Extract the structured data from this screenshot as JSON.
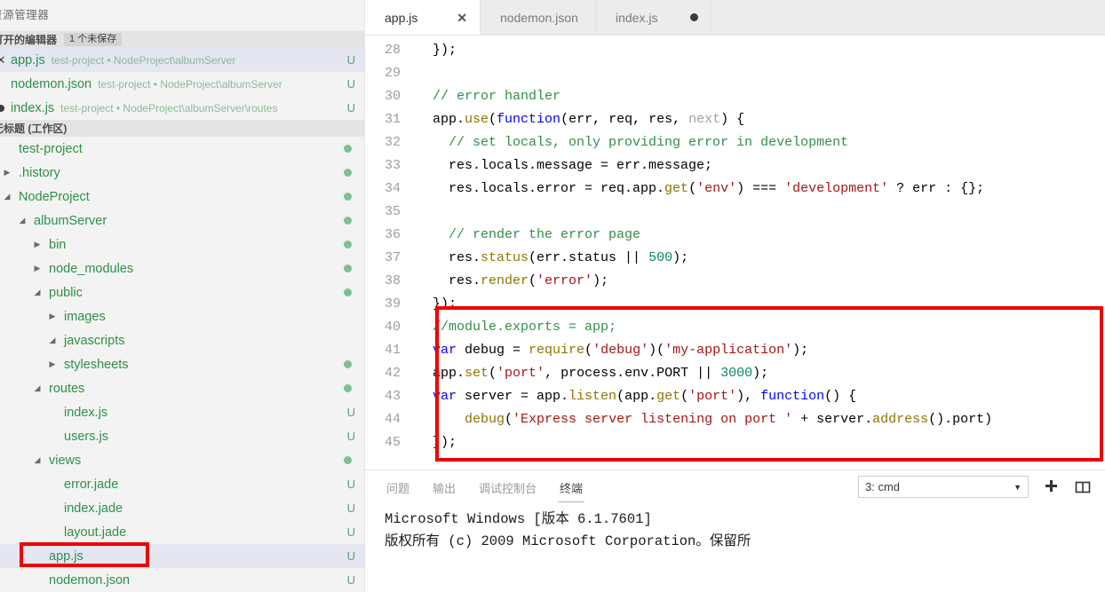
{
  "sidebar": {
    "title": "资源管理器",
    "open_editors": {
      "header_label": "打开的编辑器",
      "badge": "1 个未保存",
      "items": [
        {
          "mark": "close-icon",
          "name": "app.js",
          "description": "test-project • NodeProject\\albumServer",
          "status": "U",
          "selected": true
        },
        {
          "mark": "none",
          "name": "nodemon.json",
          "description": "test-project • NodeProject\\albumServer",
          "status": "U",
          "selected": false
        },
        {
          "mark": "dirty-dot",
          "name": "index.js",
          "description": "test-project • NodeProject\\albumServer\\routes",
          "status": "U",
          "selected": false
        }
      ]
    },
    "workspace": {
      "header_label": "无标题 (工作区)",
      "tree": [
        {
          "label": "test-project",
          "indent": 0,
          "twisty": "none",
          "status": "dot",
          "highlighted": false
        },
        {
          "label": ".history",
          "indent": 0,
          "twisty": "collapsed",
          "status": "dot",
          "highlighted": false
        },
        {
          "label": "NodeProject",
          "indent": 0,
          "twisty": "expanded",
          "status": "dot",
          "highlighted": false
        },
        {
          "label": "albumServer",
          "indent": 1,
          "twisty": "expanded",
          "status": "dot",
          "highlighted": false
        },
        {
          "label": "bin",
          "indent": 2,
          "twisty": "collapsed",
          "status": "dot",
          "highlighted": false
        },
        {
          "label": "node_modules",
          "indent": 2,
          "twisty": "collapsed",
          "status": "dot",
          "highlighted": false
        },
        {
          "label": "public",
          "indent": 2,
          "twisty": "expanded",
          "status": "dot",
          "highlighted": false
        },
        {
          "label": "images",
          "indent": 3,
          "twisty": "collapsed",
          "status": "none",
          "highlighted": false
        },
        {
          "label": "javascripts",
          "indent": 3,
          "twisty": "expanded",
          "status": "none",
          "highlighted": false
        },
        {
          "label": "stylesheets",
          "indent": 3,
          "twisty": "collapsed",
          "status": "dot",
          "highlighted": false
        },
        {
          "label": "routes",
          "indent": 2,
          "twisty": "expanded",
          "status": "dot",
          "highlighted": false
        },
        {
          "label": "index.js",
          "indent": 3,
          "twisty": "none",
          "status": "U",
          "highlighted": false
        },
        {
          "label": "users.js",
          "indent": 3,
          "twisty": "none",
          "status": "U",
          "highlighted": false
        },
        {
          "label": "views",
          "indent": 2,
          "twisty": "expanded",
          "status": "dot",
          "highlighted": false
        },
        {
          "label": "error.jade",
          "indent": 3,
          "twisty": "none",
          "status": "U",
          "highlighted": false
        },
        {
          "label": "index.jade",
          "indent": 3,
          "twisty": "none",
          "status": "U",
          "highlighted": false
        },
        {
          "label": "layout.jade",
          "indent": 3,
          "twisty": "none",
          "status": "U",
          "highlighted": false
        },
        {
          "label": "app.js",
          "indent": 2,
          "twisty": "none",
          "status": "U",
          "highlighted": true
        },
        {
          "label": "nodemon.json",
          "indent": 2,
          "twisty": "none",
          "status": "U",
          "highlighted": false
        }
      ]
    }
  },
  "editor": {
    "tabs": [
      {
        "label": "app.js",
        "active": true,
        "indicator": "close"
      },
      {
        "label": "nodemon.json",
        "active": false,
        "indicator": "none"
      },
      {
        "label": "index.js",
        "active": false,
        "indicator": "dirty"
      }
    ],
    "first_line_number": 28,
    "lines": [
      {
        "n": 28,
        "tokens": [
          {
            "t": "pln",
            "s": "  });"
          }
        ]
      },
      {
        "n": 29,
        "tokens": [
          {
            "t": "pln",
            "s": ""
          }
        ]
      },
      {
        "n": 30,
        "tokens": [
          {
            "t": "com",
            "s": "  // error handler"
          }
        ]
      },
      {
        "n": 31,
        "tokens": [
          {
            "t": "pln",
            "s": "  app."
          },
          {
            "t": "fn",
            "s": "use"
          },
          {
            "t": "pln",
            "s": "("
          },
          {
            "t": "kw",
            "s": "function"
          },
          {
            "t": "pln",
            "s": "(err, req, res, "
          },
          {
            "t": "dim",
            "s": "next"
          },
          {
            "t": "pln",
            "s": ") {"
          }
        ]
      },
      {
        "n": 32,
        "tokens": [
          {
            "t": "com",
            "s": "    // set locals, only providing error in development"
          }
        ]
      },
      {
        "n": 33,
        "tokens": [
          {
            "t": "pln",
            "s": "    res.locals.message = err.message;"
          }
        ]
      },
      {
        "n": 34,
        "tokens": [
          {
            "t": "pln",
            "s": "    res.locals.error = req.app."
          },
          {
            "t": "fn",
            "s": "get"
          },
          {
            "t": "pln",
            "s": "("
          },
          {
            "t": "str",
            "s": "'env'"
          },
          {
            "t": "pln",
            "s": ") === "
          },
          {
            "t": "str",
            "s": "'development'"
          },
          {
            "t": "pln",
            "s": " ? err : {};"
          }
        ]
      },
      {
        "n": 35,
        "tokens": [
          {
            "t": "pln",
            "s": ""
          }
        ]
      },
      {
        "n": 36,
        "tokens": [
          {
            "t": "com",
            "s": "    // render the error page"
          }
        ]
      },
      {
        "n": 37,
        "tokens": [
          {
            "t": "pln",
            "s": "    res."
          },
          {
            "t": "fn",
            "s": "status"
          },
          {
            "t": "pln",
            "s": "(err.status || "
          },
          {
            "t": "num",
            "s": "500"
          },
          {
            "t": "pln",
            "s": ");"
          }
        ]
      },
      {
        "n": 38,
        "tokens": [
          {
            "t": "pln",
            "s": "    res."
          },
          {
            "t": "fn",
            "s": "render"
          },
          {
            "t": "pln",
            "s": "("
          },
          {
            "t": "str",
            "s": "'error'"
          },
          {
            "t": "pln",
            "s": ");"
          }
        ]
      },
      {
        "n": 39,
        "tokens": [
          {
            "t": "pln",
            "s": "  });"
          }
        ]
      },
      {
        "n": 40,
        "tokens": [
          {
            "t": "com",
            "s": "  //module.exports = app;"
          }
        ]
      },
      {
        "n": 41,
        "tokens": [
          {
            "t": "kw",
            "s": "  var"
          },
          {
            "t": "pln",
            "s": " debug = "
          },
          {
            "t": "fn",
            "s": "require"
          },
          {
            "t": "pln",
            "s": "("
          },
          {
            "t": "str",
            "s": "'debug'"
          },
          {
            "t": "pln",
            "s": ")("
          },
          {
            "t": "str",
            "s": "'my-application'"
          },
          {
            "t": "pln",
            "s": ");"
          }
        ]
      },
      {
        "n": 42,
        "tokens": [
          {
            "t": "pln",
            "s": "  app."
          },
          {
            "t": "fn",
            "s": "set"
          },
          {
            "t": "pln",
            "s": "("
          },
          {
            "t": "str",
            "s": "'port'"
          },
          {
            "t": "pln",
            "s": ", process.env.PORT || "
          },
          {
            "t": "num",
            "s": "3000"
          },
          {
            "t": "pln",
            "s": ");"
          }
        ]
      },
      {
        "n": 43,
        "tokens": [
          {
            "t": "kw",
            "s": "  var"
          },
          {
            "t": "pln",
            "s": " server = app."
          },
          {
            "t": "fn",
            "s": "listen"
          },
          {
            "t": "pln",
            "s": "(app."
          },
          {
            "t": "fn",
            "s": "get"
          },
          {
            "t": "pln",
            "s": "("
          },
          {
            "t": "str",
            "s": "'port'"
          },
          {
            "t": "pln",
            "s": "), "
          },
          {
            "t": "kw",
            "s": "function"
          },
          {
            "t": "pln",
            "s": "() {"
          }
        ]
      },
      {
        "n": 44,
        "tokens": [
          {
            "t": "pln",
            "s": "      "
          },
          {
            "t": "fn",
            "s": "debug"
          },
          {
            "t": "pln",
            "s": "("
          },
          {
            "t": "str",
            "s": "'Express server listening on port '"
          },
          {
            "t": "pln",
            "s": " + server."
          },
          {
            "t": "fn",
            "s": "address"
          },
          {
            "t": "pln",
            "s": "().port)"
          }
        ]
      },
      {
        "n": 45,
        "tokens": [
          {
            "t": "pln",
            "s": "  });"
          }
        ]
      }
    ]
  },
  "panel": {
    "tabs": [
      {
        "label": "问题",
        "active": false
      },
      {
        "label": "输出",
        "active": false
      },
      {
        "label": "调试控制台",
        "active": false
      },
      {
        "label": "终端",
        "active": true
      }
    ],
    "terminal_select": {
      "value": "3: cmd",
      "caret": "▼"
    },
    "actions": [
      {
        "name": "new-terminal-button",
        "glyph": "✚"
      },
      {
        "name": "split-terminal-button",
        "glyph": "⊓"
      }
    ],
    "terminal_output": "Microsoft Windows [版本 6.1.7601]\n版权所有 (c) 2009 Microsoft Corporation。保留所"
  },
  "annotations": {
    "code_block_highlight": "red-rectangle-lines-40-45",
    "sidebar_file_highlight": "red-rectangle-app-js"
  },
  "colors": {
    "annotation_red": "#ef0000",
    "git_green": "#2f8f46",
    "selection_blue": "#e4e6f1"
  }
}
